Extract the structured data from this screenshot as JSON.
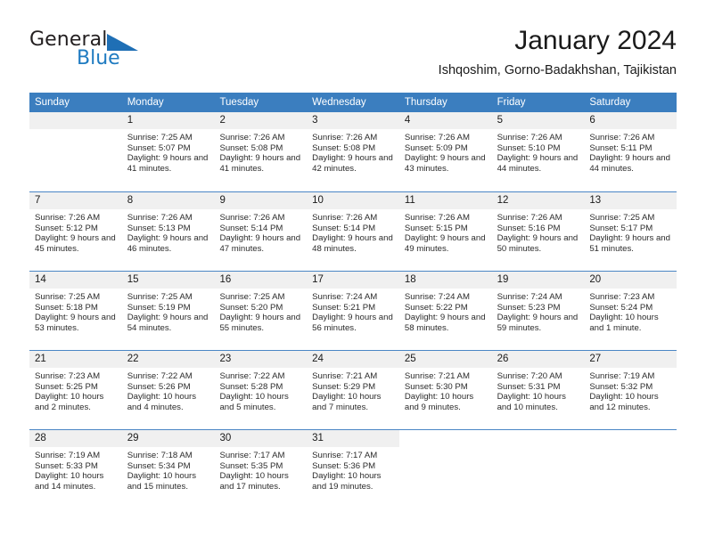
{
  "brand": {
    "word1": "General",
    "word2": "Blue",
    "triangle_color": "#1f6fb5",
    "blue_color": "#1f7bc1"
  },
  "header": {
    "title": "January 2024",
    "subtitle": "Ishqoshim, Gorno-Badakhshan, Tajikistan"
  },
  "theme": {
    "header_blue": "#3b7ebf",
    "day_band_gray": "#f0f0f0",
    "row_divider": "#4a86c5"
  },
  "weekdays": [
    "Sunday",
    "Monday",
    "Tuesday",
    "Wednesday",
    "Thursday",
    "Friday",
    "Saturday"
  ],
  "weeks": [
    [
      {
        "date": "",
        "sunrise": "",
        "sunset": "",
        "daylight": "",
        "empty": true
      },
      {
        "date": "1",
        "sunrise": "Sunrise: 7:25 AM",
        "sunset": "Sunset: 5:07 PM",
        "daylight": "Daylight: 9 hours and 41 minutes."
      },
      {
        "date": "2",
        "sunrise": "Sunrise: 7:26 AM",
        "sunset": "Sunset: 5:08 PM",
        "daylight": "Daylight: 9 hours and 41 minutes."
      },
      {
        "date": "3",
        "sunrise": "Sunrise: 7:26 AM",
        "sunset": "Sunset: 5:08 PM",
        "daylight": "Daylight: 9 hours and 42 minutes."
      },
      {
        "date": "4",
        "sunrise": "Sunrise: 7:26 AM",
        "sunset": "Sunset: 5:09 PM",
        "daylight": "Daylight: 9 hours and 43 minutes."
      },
      {
        "date": "5",
        "sunrise": "Sunrise: 7:26 AM",
        "sunset": "Sunset: 5:10 PM",
        "daylight": "Daylight: 9 hours and 44 minutes."
      },
      {
        "date": "6",
        "sunrise": "Sunrise: 7:26 AM",
        "sunset": "Sunset: 5:11 PM",
        "daylight": "Daylight: 9 hours and 44 minutes."
      }
    ],
    [
      {
        "date": "7",
        "sunrise": "Sunrise: 7:26 AM",
        "sunset": "Sunset: 5:12 PM",
        "daylight": "Daylight: 9 hours and 45 minutes."
      },
      {
        "date": "8",
        "sunrise": "Sunrise: 7:26 AM",
        "sunset": "Sunset: 5:13 PM",
        "daylight": "Daylight: 9 hours and 46 minutes."
      },
      {
        "date": "9",
        "sunrise": "Sunrise: 7:26 AM",
        "sunset": "Sunset: 5:14 PM",
        "daylight": "Daylight: 9 hours and 47 minutes."
      },
      {
        "date": "10",
        "sunrise": "Sunrise: 7:26 AM",
        "sunset": "Sunset: 5:14 PM",
        "daylight": "Daylight: 9 hours and 48 minutes."
      },
      {
        "date": "11",
        "sunrise": "Sunrise: 7:26 AM",
        "sunset": "Sunset: 5:15 PM",
        "daylight": "Daylight: 9 hours and 49 minutes."
      },
      {
        "date": "12",
        "sunrise": "Sunrise: 7:26 AM",
        "sunset": "Sunset: 5:16 PM",
        "daylight": "Daylight: 9 hours and 50 minutes."
      },
      {
        "date": "13",
        "sunrise": "Sunrise: 7:25 AM",
        "sunset": "Sunset: 5:17 PM",
        "daylight": "Daylight: 9 hours and 51 minutes."
      }
    ],
    [
      {
        "date": "14",
        "sunrise": "Sunrise: 7:25 AM",
        "sunset": "Sunset: 5:18 PM",
        "daylight": "Daylight: 9 hours and 53 minutes."
      },
      {
        "date": "15",
        "sunrise": "Sunrise: 7:25 AM",
        "sunset": "Sunset: 5:19 PM",
        "daylight": "Daylight: 9 hours and 54 minutes."
      },
      {
        "date": "16",
        "sunrise": "Sunrise: 7:25 AM",
        "sunset": "Sunset: 5:20 PM",
        "daylight": "Daylight: 9 hours and 55 minutes."
      },
      {
        "date": "17",
        "sunrise": "Sunrise: 7:24 AM",
        "sunset": "Sunset: 5:21 PM",
        "daylight": "Daylight: 9 hours and 56 minutes."
      },
      {
        "date": "18",
        "sunrise": "Sunrise: 7:24 AM",
        "sunset": "Sunset: 5:22 PM",
        "daylight": "Daylight: 9 hours and 58 minutes."
      },
      {
        "date": "19",
        "sunrise": "Sunrise: 7:24 AM",
        "sunset": "Sunset: 5:23 PM",
        "daylight": "Daylight: 9 hours and 59 minutes."
      },
      {
        "date": "20",
        "sunrise": "Sunrise: 7:23 AM",
        "sunset": "Sunset: 5:24 PM",
        "daylight": "Daylight: 10 hours and 1 minute."
      }
    ],
    [
      {
        "date": "21",
        "sunrise": "Sunrise: 7:23 AM",
        "sunset": "Sunset: 5:25 PM",
        "daylight": "Daylight: 10 hours and 2 minutes."
      },
      {
        "date": "22",
        "sunrise": "Sunrise: 7:22 AM",
        "sunset": "Sunset: 5:26 PM",
        "daylight": "Daylight: 10 hours and 4 minutes."
      },
      {
        "date": "23",
        "sunrise": "Sunrise: 7:22 AM",
        "sunset": "Sunset: 5:28 PM",
        "daylight": "Daylight: 10 hours and 5 minutes."
      },
      {
        "date": "24",
        "sunrise": "Sunrise: 7:21 AM",
        "sunset": "Sunset: 5:29 PM",
        "daylight": "Daylight: 10 hours and 7 minutes."
      },
      {
        "date": "25",
        "sunrise": "Sunrise: 7:21 AM",
        "sunset": "Sunset: 5:30 PM",
        "daylight": "Daylight: 10 hours and 9 minutes."
      },
      {
        "date": "26",
        "sunrise": "Sunrise: 7:20 AM",
        "sunset": "Sunset: 5:31 PM",
        "daylight": "Daylight: 10 hours and 10 minutes."
      },
      {
        "date": "27",
        "sunrise": "Sunrise: 7:19 AM",
        "sunset": "Sunset: 5:32 PM",
        "daylight": "Daylight: 10 hours and 12 minutes."
      }
    ],
    [
      {
        "date": "28",
        "sunrise": "Sunrise: 7:19 AM",
        "sunset": "Sunset: 5:33 PM",
        "daylight": "Daylight: 10 hours and 14 minutes."
      },
      {
        "date": "29",
        "sunrise": "Sunrise: 7:18 AM",
        "sunset": "Sunset: 5:34 PM",
        "daylight": "Daylight: 10 hours and 15 minutes."
      },
      {
        "date": "30",
        "sunrise": "Sunrise: 7:17 AM",
        "sunset": "Sunset: 5:35 PM",
        "daylight": "Daylight: 10 hours and 17 minutes."
      },
      {
        "date": "31",
        "sunrise": "Sunrise: 7:17 AM",
        "sunset": "Sunset: 5:36 PM",
        "daylight": "Daylight: 10 hours and 19 minutes."
      },
      {
        "date": "",
        "sunrise": "",
        "sunset": "",
        "daylight": "",
        "empty": true,
        "noband": true
      },
      {
        "date": "",
        "sunrise": "",
        "sunset": "",
        "daylight": "",
        "empty": true,
        "noband": true
      },
      {
        "date": "",
        "sunrise": "",
        "sunset": "",
        "daylight": "",
        "empty": true,
        "noband": true
      }
    ]
  ]
}
